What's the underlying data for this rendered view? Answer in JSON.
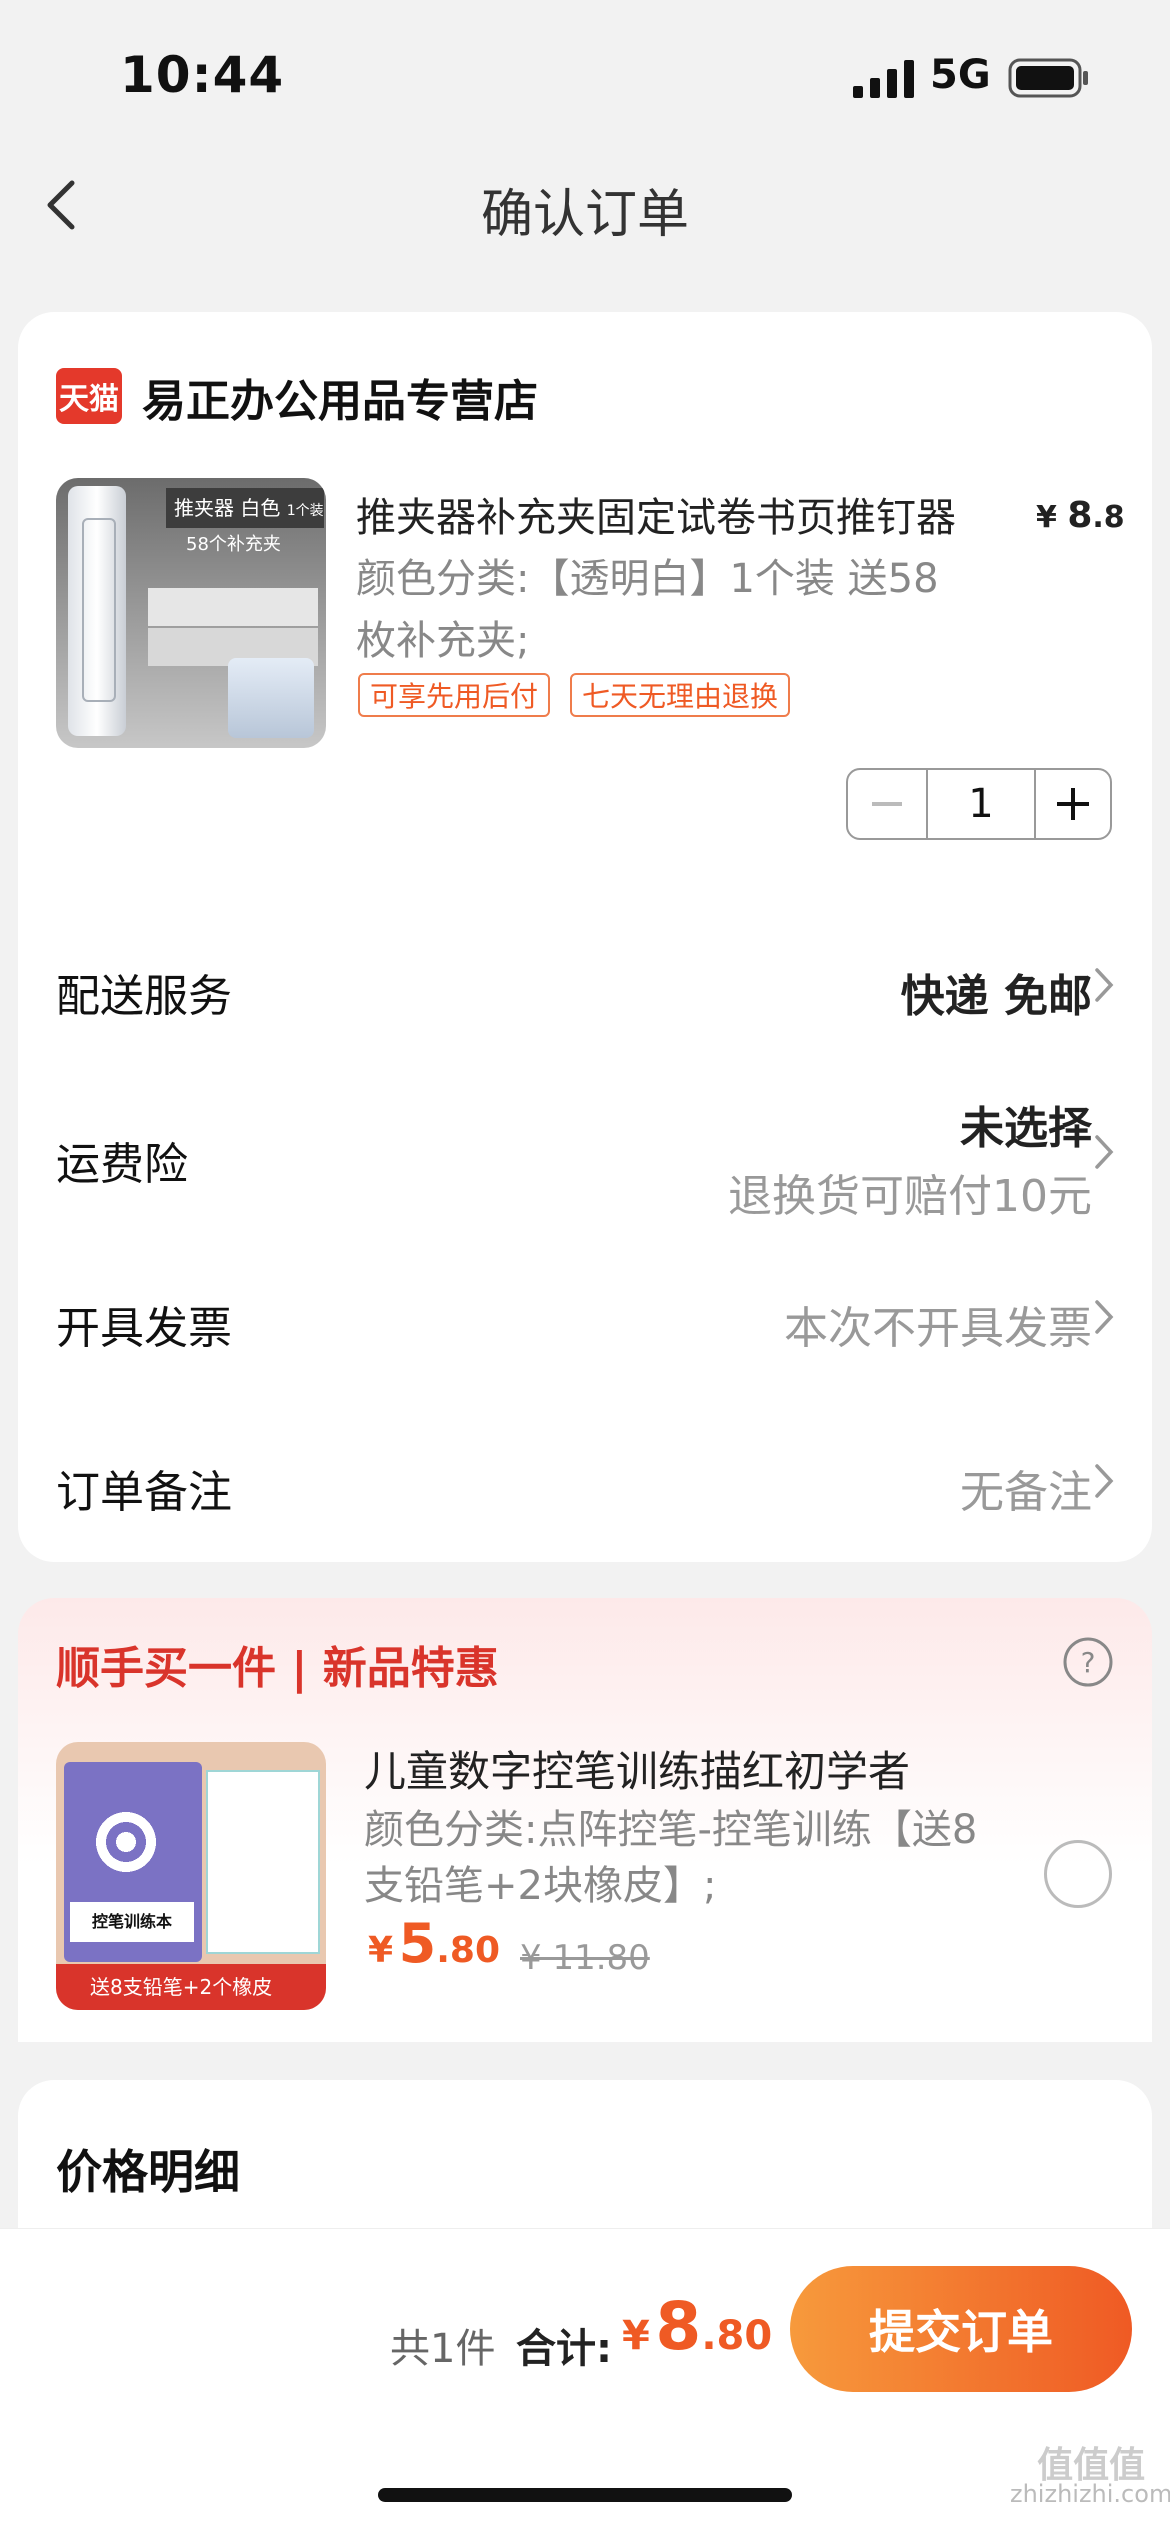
{
  "status": {
    "time": "10:44",
    "network": "5G"
  },
  "nav": {
    "title": "确认订单"
  },
  "store": {
    "badge": "天猫",
    "name": "易正办公用品专营店",
    "product": {
      "title": "推夹器补充夹固定试卷书页推钉器",
      "price_symbol": "¥",
      "price_int": "8",
      "price_dec": ".8",
      "spec": "颜色分类:【透明白】1个装 送58枚补充夹;",
      "image_text_1": "推夹器 白色",
      "image_text_2": "1个装",
      "image_text_3": "58个补充夹",
      "tags": [
        "可享先用后付",
        "七天无理由退换"
      ],
      "quantity": "1"
    },
    "rows": {
      "delivery": {
        "label": "配送服务",
        "value": "快递 免邮"
      },
      "insurance": {
        "label": "运费险",
        "value": "未选择",
        "sub": "退换货可赔付10元"
      },
      "invoice": {
        "label": "开具发票",
        "value": "本次不开具发票"
      },
      "note": {
        "label": "订单备注",
        "value": "无备注"
      }
    }
  },
  "promo": {
    "title": "顺手买一件 | 新品特惠",
    "item": {
      "name": "儿童数字控笔训练描红初学者",
      "spec": "颜色分类:点阵控笔-控笔训练【送8支铅笔+2块橡皮】;",
      "price_symbol": "¥",
      "price_int": "5",
      "price_dec": ".80",
      "old_price": "¥ 11.80",
      "image_book_title": "控笔训练本",
      "image_banner": "送8支铅笔+2个橡皮"
    }
  },
  "price_detail": {
    "title": "价格明细"
  },
  "bottom": {
    "count": "共1件",
    "total_label": "合计:",
    "price_symbol": "¥",
    "price_int": "8",
    "price_dec": ".80",
    "submit": "提交订单"
  },
  "watermark": {
    "line1": "值值值",
    "line2": "zhizhizhi.com"
  },
  "colors": {
    "accent": "#ef5a24",
    "tmall": "#e4392b",
    "promo_red": "#d9342b"
  }
}
